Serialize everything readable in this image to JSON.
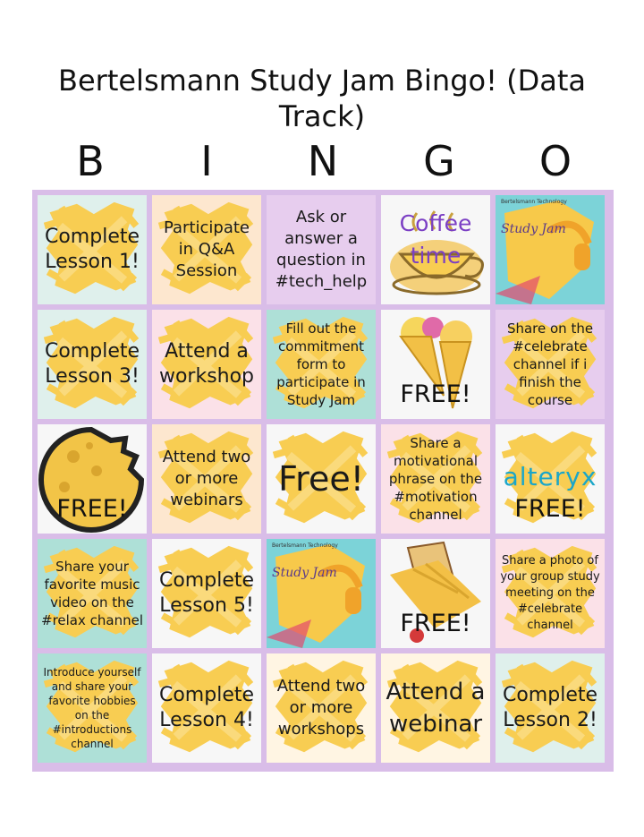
{
  "title": "Bertelsmann Study Jam Bingo! (Data Track)",
  "letters": [
    "B",
    "I",
    "N",
    "G",
    "O"
  ],
  "colors": {
    "board": "#d9bde8",
    "splash": "#f8cd52"
  },
  "cells": [
    {
      "text": "Complete Lesson 1!"
    },
    {
      "text": "Participate in Q&A Session"
    },
    {
      "text": "Ask or answer a question in #tech_help"
    },
    {
      "text": "Coffee time",
      "icon": "coffee-cup-icon"
    },
    {
      "text": "Bertelsmann Technology",
      "poster": "Study Jam",
      "icon": "headphones-poster-image"
    },
    {
      "text": "Complete Lesson 3!"
    },
    {
      "text": "Attend a workshop"
    },
    {
      "text": "Fill out the commitment form to participate in Study Jam"
    },
    {
      "text": "FREE!",
      "icon": "ice-cream-icon"
    },
    {
      "text": "Share on the #celebrate channel if i finish the course"
    },
    {
      "text": "FREE!",
      "icon": "cookie-icon"
    },
    {
      "text": "Attend two or more webinars"
    },
    {
      "text": "Free!"
    },
    {
      "text": "Share a motivational phrase on the #motivation channel"
    },
    {
      "text": "FREE!",
      "brand": "alteryx",
      "icon": "alteryx-logo"
    },
    {
      "text": "Share your favorite music video on the #relax channel"
    },
    {
      "text": "Complete Lesson 5!"
    },
    {
      "text": "Bertelsmann Technology",
      "poster": "Study Jam",
      "icon": "headphones-poster-image"
    },
    {
      "text": "FREE!",
      "icon": "chocolate-bar-icon"
    },
    {
      "text": "Share a photo of your group study meeting on the #celebrate channel"
    },
    {
      "text": "Introduce yourself and share your favorite hobbies on the #introductions channel"
    },
    {
      "text": "Complete Lesson 4!"
    },
    {
      "text": "Attend two or more workshops"
    },
    {
      "text": "Attend a webinar"
    },
    {
      "text": "Complete Lesson 2!"
    }
  ]
}
